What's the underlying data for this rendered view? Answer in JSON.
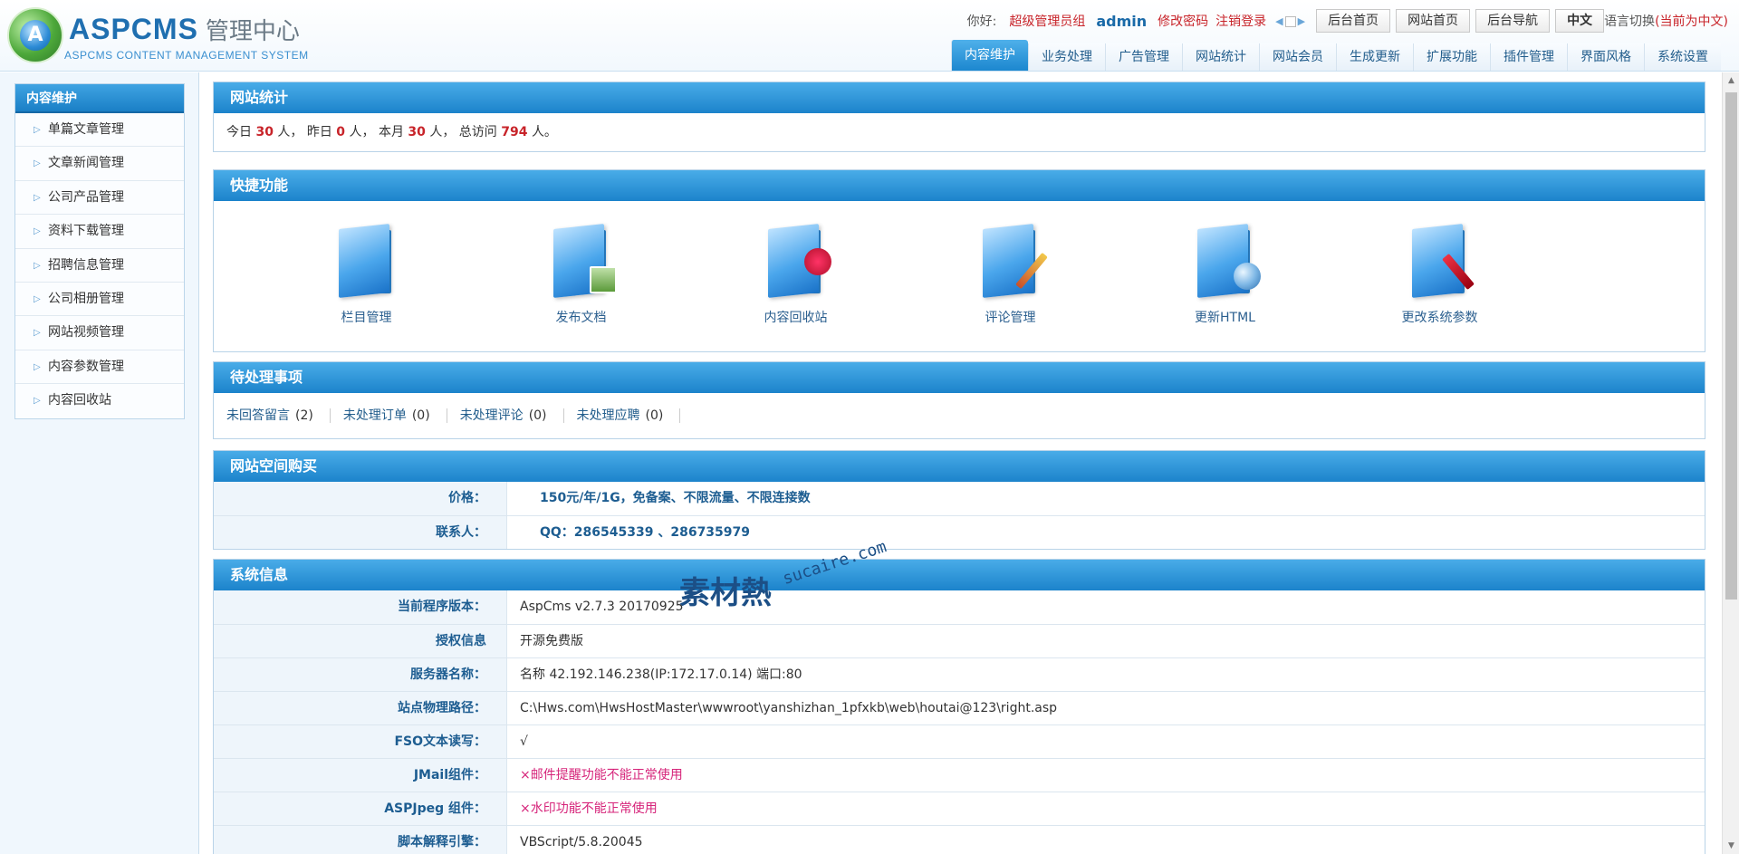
{
  "header": {
    "brand": "ASPCMS",
    "brand_sub": "管理中心",
    "brand_en": "ASPCMS CONTENT MANAGEMENT SYSTEM",
    "logo_letter": "A",
    "greeting": "你好:",
    "role": "超级管理员组",
    "username": "admin",
    "change_password": "修改密码",
    "logout": "注销登录",
    "buttons": [
      "后台首页",
      "网站首页",
      "后台导航",
      "中文"
    ],
    "lang_label": "语言切换",
    "lang_current": "(当前为中文)",
    "tabs": [
      "内容维护",
      "业务处理",
      "广告管理",
      "网站统计",
      "网站会员",
      "生成更新",
      "扩展功能",
      "插件管理",
      "界面风格",
      "系统设置"
    ]
  },
  "sidebar": {
    "title": "内容维护",
    "items": [
      "单篇文章管理",
      "文章新闻管理",
      "公司产品管理",
      "资料下载管理",
      "招聘信息管理",
      "公司相册管理",
      "网站视频管理",
      "内容参数管理",
      "内容回收站"
    ]
  },
  "stats_panel": {
    "title": "网站统计",
    "t1": "今日",
    "today": "30",
    "t2": "人，  昨日",
    "yesterday": "0",
    "t3": "人，  本月",
    "month": "30",
    "t4": "人，  总访问",
    "total": "794",
    "t5": "人。"
  },
  "quick_panel": {
    "title": "快捷功能",
    "items": [
      {
        "label": "栏目管理",
        "icon": "folder-book-icon"
      },
      {
        "label": "发布文档",
        "icon": "folder-picture-icon"
      },
      {
        "label": "内容回收站",
        "icon": "folder-recycle-icon"
      },
      {
        "label": "评论管理",
        "icon": "folder-pencil-icon"
      },
      {
        "label": "更新HTML",
        "icon": "folder-globe-icon"
      },
      {
        "label": "更改系统参数",
        "icon": "folder-tools-icon"
      }
    ]
  },
  "todo_panel": {
    "title": "待处理事项",
    "items": [
      {
        "label": "未回答留言",
        "count": "(2)"
      },
      {
        "label": "未处理订单",
        "count": "(0)"
      },
      {
        "label": "未处理评论",
        "count": "(0)"
      },
      {
        "label": "未处理应聘",
        "count": "(0)"
      }
    ]
  },
  "space_panel": {
    "title": "网站空间购买",
    "rows": [
      {
        "k": "价格：",
        "v": "150元/年/1G，免备案、不限流量、不限连接数"
      },
      {
        "k": "联系人：",
        "v": "QQ：286545339 、286735979"
      }
    ]
  },
  "sys_panel": {
    "title": "系统信息",
    "rows": [
      {
        "k": "当前程序版本：",
        "v": "AspCms v2.7.3 20170925"
      },
      {
        "k": "授权信息",
        "v": "开源免费版"
      },
      {
        "k": "服务器名称：",
        "v": "名称 42.192.146.238(IP:172.17.0.14) 端口:80"
      },
      {
        "k": "站点物理路径：",
        "v": "C:\\Hws.com\\HwsHostMaster\\wwwroot\\yanshizhan_1pfxkb\\web\\houtai@123\\right.asp"
      },
      {
        "k": "FSO文本读写：",
        "v": "√"
      },
      {
        "k": "JMail组件：",
        "v": "×邮件提醒功能不能正常使用"
      },
      {
        "k": "ASPJpeg 组件：",
        "v": "×水印功能不能正常使用"
      },
      {
        "k": "脚本解释引擎：",
        "v": "VBScript/5.8.20045"
      }
    ]
  },
  "watermark": {
    "cn": "素材熱",
    "en": "sucaire.com"
  }
}
